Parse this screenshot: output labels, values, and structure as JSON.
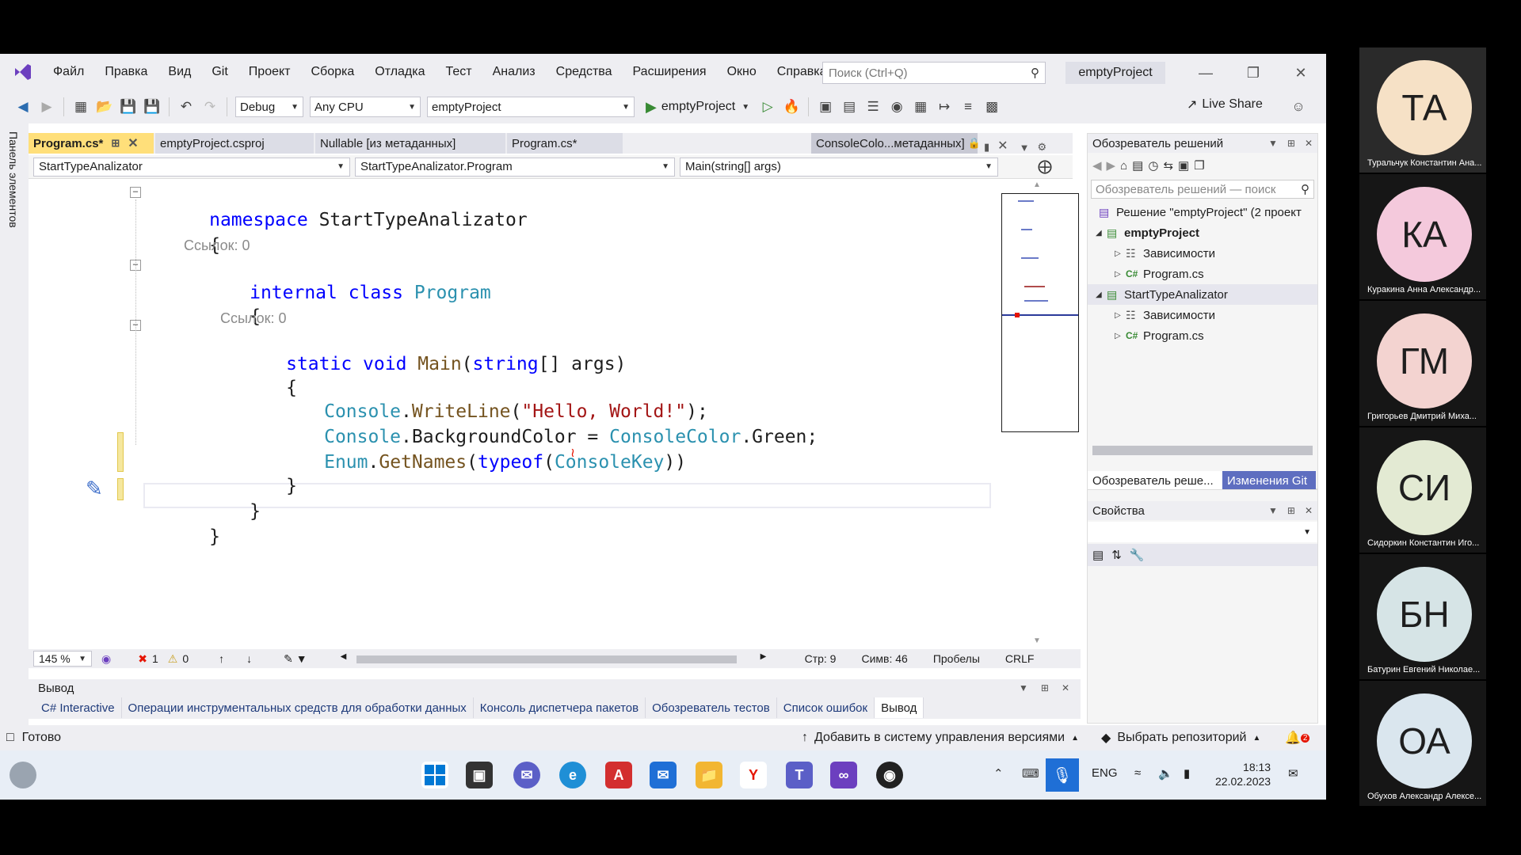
{
  "menu": {
    "items": [
      "Файл",
      "Правка",
      "Вид",
      "Git",
      "Проект",
      "Сборка",
      "Отладка",
      "Тест",
      "Анализ",
      "Средства",
      "Расширения",
      "Окно",
      "Справка"
    ],
    "search_placeholder": "Поиск (Ctrl+Q)",
    "project_title": "emptyProject"
  },
  "toolbar": {
    "config": "Debug",
    "platform": "Any CPU",
    "startup_project": "emptyProject",
    "run_label": "emptyProject",
    "live_share": "Live Share"
  },
  "toolbox_label": "Панель элементов",
  "doc_tabs": [
    {
      "label": "Program.cs*",
      "state": "active"
    },
    {
      "label": "emptyProject.csproj",
      "state": "inactive"
    },
    {
      "label": "Nullable [из метаданных]",
      "state": "inactive"
    },
    {
      "label": "Program.cs*",
      "state": "inactive"
    },
    {
      "label": "ConsoleColo...метаданных]",
      "state": "preview"
    }
  ],
  "navbar": {
    "project": "StartTypeAnalizator",
    "type": "StartTypeAnalizator.Program",
    "member": "Main(string[] args)"
  },
  "code": {
    "line1_kw": "namespace",
    "line1_name": " StartTypeAnalizator",
    "brace_open": "{",
    "brace_close": "}",
    "lens1": "Ссылок: 0",
    "line3_kw": "internal class",
    "line3_type": "Program",
    "lens2": "Ссылок: 0",
    "line5_kw1": "static void",
    "line5_method": "Main",
    "line5_open": "(",
    "line5_kw2": "string",
    "line5_rest": "[] args)",
    "line7_type": "Console",
    "line7_dot": ".",
    "line7_method": "WriteLine",
    "line7_open": "(",
    "line7_str": "\"Hello, World!\"",
    "line7_close": ");",
    "line8_type": "Console",
    "line8_mid": ".BackgroundColor = ",
    "line8_type2": "ConsoleColor",
    "line8_end": ".Green;",
    "line9_type": "Enum",
    "line9_dot": ".",
    "line9_method": "GetNames",
    "line9_open": "(",
    "line9_kw": "typeof",
    "line9_open2": "(",
    "line9_type2": "ConsoleKey",
    "line9_close": "))"
  },
  "editor_status": {
    "zoom": "145 %",
    "errors": "1",
    "warnings": "0",
    "line": "Стр: 9",
    "col": "Симв: 46",
    "whitespace": "Пробелы",
    "eol": "CRLF"
  },
  "output": {
    "title": "Вывод",
    "tabs": [
      "C# Interactive",
      "Операции инструментальных средств для обработки данных",
      "Консоль диспетчера пакетов",
      "Обозреватель тестов",
      "Список ошибок",
      "Вывод"
    ]
  },
  "statusbar": {
    "ready": "Готово",
    "add_source_control": "Добавить в систему управления версиями",
    "select_repo": "Выбрать репозиторий",
    "notifications": "2"
  },
  "solution_explorer": {
    "title": "Обозреватель решений",
    "search_placeholder": "Обозреватель решений — поиск",
    "items": [
      {
        "label": "Решение \"emptyProject\" (2 проект",
        "level": 0,
        "arrow": "",
        "icon": "solution-icon"
      },
      {
        "label": "emptyProject",
        "level": 1,
        "arrow": "◢",
        "icon": "csharp-project-icon",
        "bold": true
      },
      {
        "label": "Зависимости",
        "level": 2,
        "arrow": "▷",
        "icon": "dependencies-icon"
      },
      {
        "label": "Program.cs",
        "level": 2,
        "arrow": "▷",
        "icon": "csharp-file-icon"
      },
      {
        "label": "StartTypeAnalizator",
        "level": 1,
        "arrow": "◢",
        "icon": "csharp-project-icon",
        "selected": true
      },
      {
        "label": "Зависимости",
        "level": 2,
        "arrow": "▷",
        "icon": "dependencies-icon"
      },
      {
        "label": "Program.cs",
        "level": 2,
        "arrow": "▷",
        "icon": "csharp-file-icon"
      }
    ],
    "tab_solution": "Обозреватель реше...",
    "tab_git": "Изменения Git"
  },
  "properties": {
    "title": "Свойства"
  },
  "taskbar": {
    "lang": "ENG",
    "time": "18:13",
    "date": "22.02.2023"
  },
  "participants": [
    {
      "initials": "ТА",
      "name": "Туральчук Константин Ана...",
      "color": "#f6e1c6"
    },
    {
      "initials": "КА",
      "name": "Куракина Анна Александр...",
      "color": "#f4c9dc"
    },
    {
      "initials": "ГМ",
      "name": "Григорьев Дмитрий Миха...",
      "color": "#f3d3d0"
    },
    {
      "initials": "СИ",
      "name": "Сидоркин Константин Иго...",
      "color": "#e3ead3"
    },
    {
      "initials": "БН",
      "name": "Батурин Евгений Николае...",
      "color": "#d6e4e6"
    },
    {
      "initials": "ОА",
      "name": "Обухов Александр Алексе...",
      "color": "#dae6ee"
    }
  ],
  "colors": {
    "active_tab": "#ffdf7a",
    "keyword": "#0000ff",
    "type": "#2b91af",
    "method": "#74531f",
    "string": "#a31515"
  }
}
